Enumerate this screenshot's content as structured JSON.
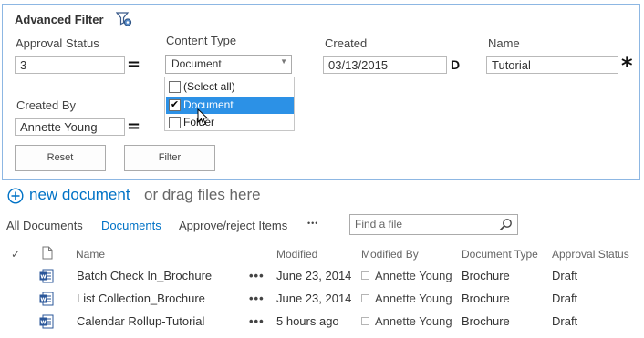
{
  "filter": {
    "title": "Advanced Filter",
    "approval_status": {
      "label": "Approval Status",
      "value": "3",
      "operator": "="
    },
    "content_type": {
      "label": "Content Type",
      "selected": "Document",
      "options": [
        {
          "label": "(Select all)",
          "checked": false
        },
        {
          "label": "Document",
          "checked": true
        },
        {
          "label": "Folder",
          "checked": false
        }
      ]
    },
    "created": {
      "label": "Created",
      "value": "03/13/2015",
      "operator": "D"
    },
    "name": {
      "label": "Name",
      "value": "Tutorial",
      "operator": "*"
    },
    "created_by": {
      "label": "Created By",
      "value": "Annette Young",
      "operator": "="
    },
    "reset_label": "Reset",
    "filter_label": "Filter"
  },
  "actions": {
    "new_document": "new document",
    "drag_text": "or drag files here"
  },
  "views": {
    "items": [
      "All Documents",
      "Documents",
      "Approve/reject Items"
    ],
    "active": "Documents",
    "more": "•••",
    "search_placeholder": "Find a file"
  },
  "list": {
    "headers": {
      "check": "✓",
      "name": "Name",
      "modified": "Modified",
      "modified_by": "Modified By",
      "document_type": "Document Type",
      "approval_status": "Approval Status"
    },
    "rows": [
      {
        "name": "Batch Check In_Brochure",
        "modified": "June 23, 2014",
        "modified_by": "Annette Young",
        "document_type": "Brochure",
        "approval_status": "Draft"
      },
      {
        "name": "List Collection_Brochure",
        "modified": "June 23, 2014",
        "modified_by": "Annette Young",
        "document_type": "Brochure",
        "approval_status": "Draft"
      },
      {
        "name": "Calendar Rollup-Tutorial",
        "modified": "5 hours ago",
        "modified_by": "Annette Young",
        "document_type": "Brochure",
        "approval_status": "Draft"
      }
    ]
  },
  "colors": {
    "link_blue": "#0072c6",
    "panel_border": "#8db7e3",
    "selection": "#2c91e6"
  },
  "icons": [
    "filter-settings-icon",
    "add-circle-icon",
    "search-icon",
    "document-header-icon",
    "word-document-icon"
  ]
}
